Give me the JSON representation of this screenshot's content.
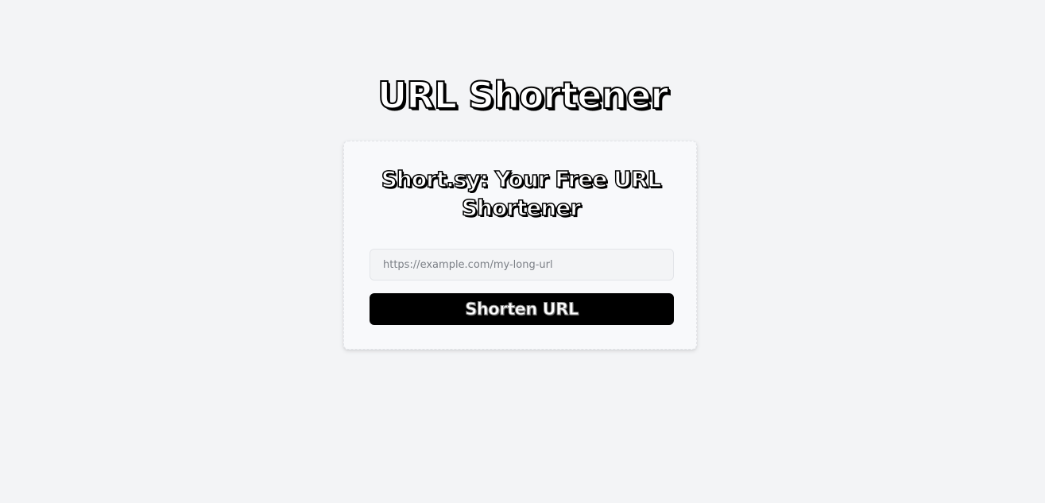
{
  "header": {
    "title": "URL Shortener"
  },
  "card": {
    "title": "Short.sy: Your Free URL Shortener",
    "input": {
      "value": "",
      "placeholder": "https://example.com/my-long-url"
    },
    "button_label": "Shorten URL"
  },
  "colors": {
    "background": "#f3f4f6",
    "card_background": "#f8f9fb",
    "button_background": "#000000",
    "title_fill": "#ffffff",
    "title_stroke": "#000000"
  }
}
